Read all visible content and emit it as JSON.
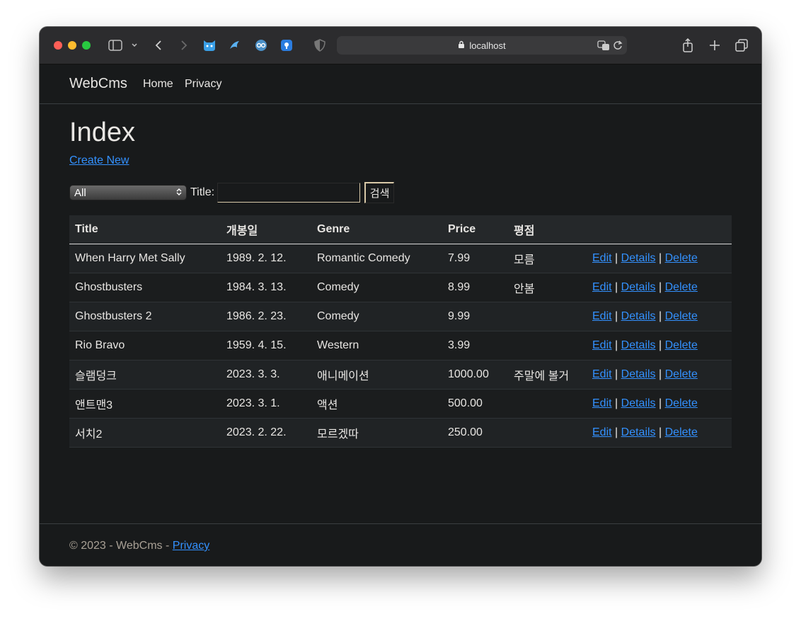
{
  "browser": {
    "url": "localhost"
  },
  "nav": {
    "brand": "WebCms",
    "links": [
      "Home",
      "Privacy"
    ]
  },
  "main": {
    "heading": "Index",
    "create_link": "Create New",
    "filter": {
      "genre_selected": "All",
      "title_label": "Title:",
      "title_value": "",
      "search_label": "검색"
    },
    "table": {
      "headers": [
        "Title",
        "개봉일",
        "Genre",
        "Price",
        "평점",
        ""
      ],
      "rows": [
        {
          "title": "When Harry Met Sally",
          "date": "1989. 2. 12.",
          "genre": "Romantic Comedy",
          "price": "7.99",
          "rating": "모름"
        },
        {
          "title": "Ghostbusters",
          "date": "1984. 3. 13.",
          "genre": "Comedy",
          "price": "8.99",
          "rating": "안봄"
        },
        {
          "title": "Ghostbusters 2",
          "date": "1986. 2. 23.",
          "genre": "Comedy",
          "price": "9.99",
          "rating": ""
        },
        {
          "title": "Rio Bravo",
          "date": "1959. 4. 15.",
          "genre": "Western",
          "price": "3.99",
          "rating": ""
        },
        {
          "title": "슬램덩크",
          "date": "2023. 3. 3.",
          "genre": "애니메이션",
          "price": "1000.00",
          "rating": "주말에 볼거"
        },
        {
          "title": "앤트맨3",
          "date": "2023. 3. 1.",
          "genre": "액션",
          "price": "500.00",
          "rating": ""
        },
        {
          "title": "서치2",
          "date": "2023. 2. 22.",
          "genre": "모르겠따",
          "price": "250.00",
          "rating": ""
        }
      ],
      "actions": {
        "edit": "Edit",
        "details": "Details",
        "delete": "Delete",
        "separator": "|"
      }
    }
  },
  "footer": {
    "text": "© 2023 - WebCms - ",
    "privacy_link": "Privacy"
  },
  "colors": {
    "link": "#3391ff",
    "page_bg": "#181a1b",
    "text": "#e8e6e3"
  }
}
